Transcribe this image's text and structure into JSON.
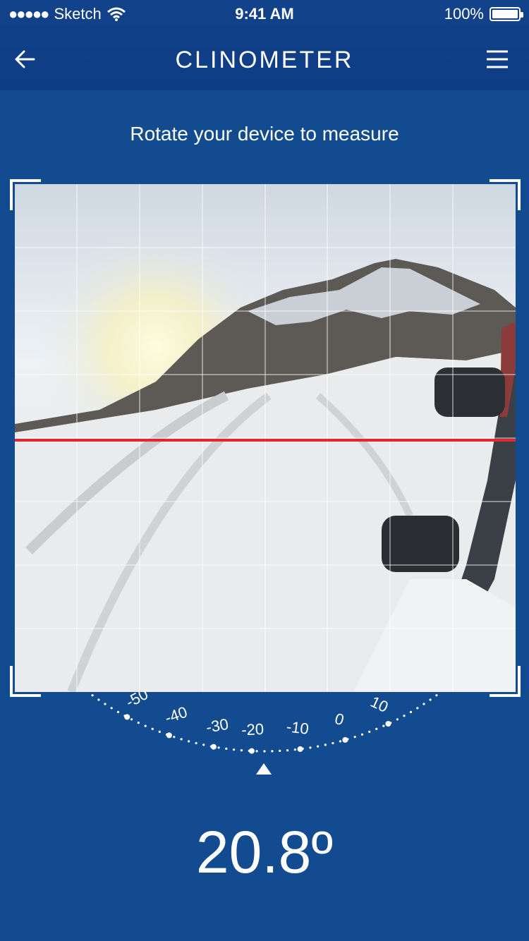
{
  "status_bar": {
    "signal": "●●●●●",
    "carrier": "Sketch",
    "time": "9:41 AM",
    "battery": "100%"
  },
  "nav": {
    "title": "CLINOMETER",
    "back_icon": "back-arrow-icon",
    "menu_icon": "menu-icon"
  },
  "prompt": "Rotate your device to measure",
  "dial": {
    "ticks": [
      "-50",
      "-40",
      "-30",
      "-20",
      "-10",
      "0",
      "10"
    ]
  },
  "reading": "20.8º",
  "colors": {
    "background": "#124b8f",
    "level_line": "#e0282e"
  }
}
